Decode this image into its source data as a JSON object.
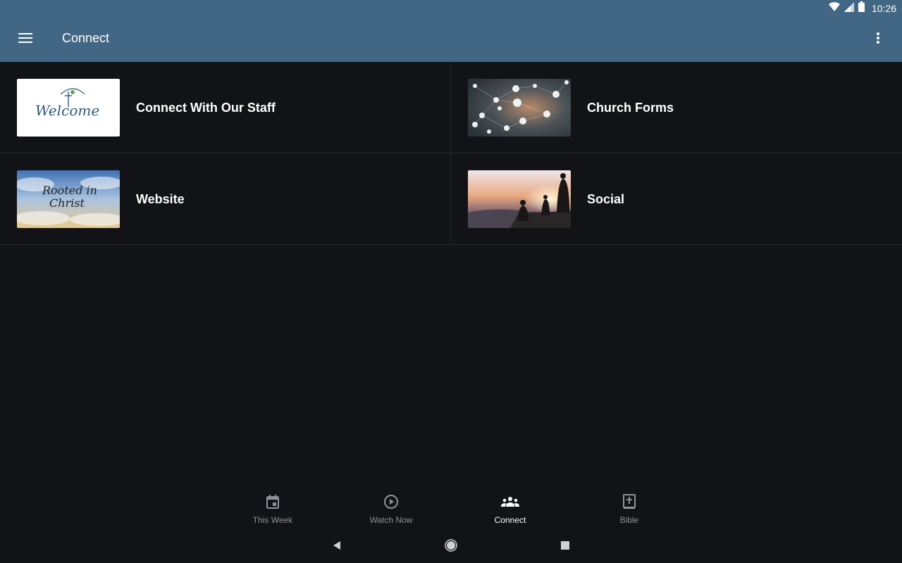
{
  "status_bar": {
    "time": "10:26"
  },
  "app_bar": {
    "title": "Connect"
  },
  "tiles": [
    {
      "label": "Connect With Our Staff",
      "thumb_text": "Welcome"
    },
    {
      "label": "Church Forms"
    },
    {
      "label": "Website",
      "thumb_text_line1": "Rooted in",
      "thumb_text_line2": "Christ"
    },
    {
      "label": "Social"
    }
  ],
  "bottom_nav": [
    {
      "label": "This Week",
      "icon": "calendar-icon",
      "active": false
    },
    {
      "label": "Watch Now",
      "icon": "play-circle-icon",
      "active": false
    },
    {
      "label": "Connect",
      "icon": "group-icon",
      "active": true
    },
    {
      "label": "Bible",
      "icon": "bible-icon",
      "active": false
    }
  ],
  "colors": {
    "app_bar": "#426784",
    "background": "#121316",
    "inactive_nav": "#8f9297",
    "active_nav": "#ffffff"
  }
}
